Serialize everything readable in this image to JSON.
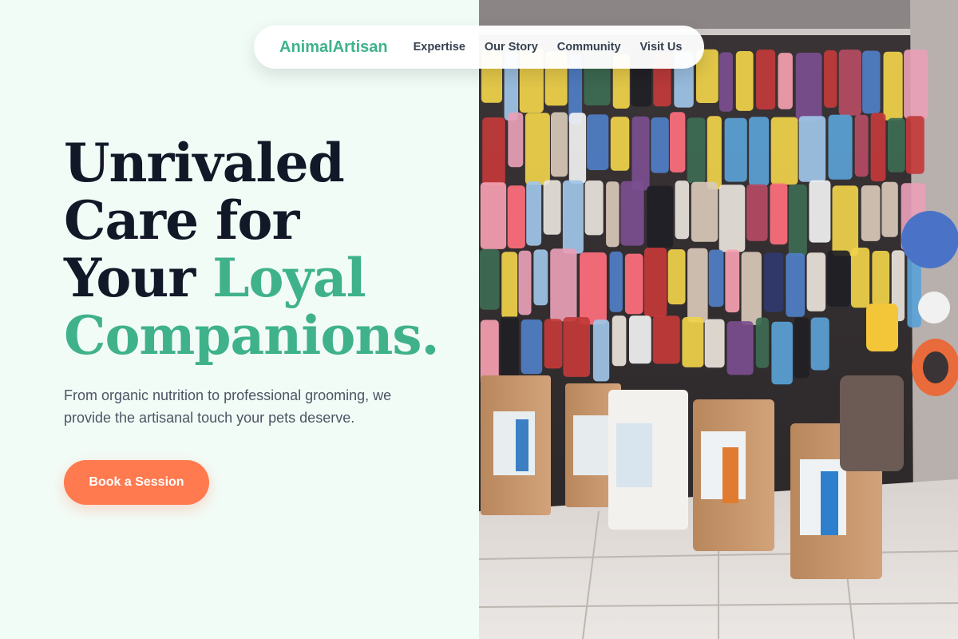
{
  "nav": {
    "logo": "AnimalArtisan",
    "links": [
      "Expertise",
      "Our Story",
      "Community",
      "Visit Us"
    ]
  },
  "hero": {
    "title_line1": "Unrivaled",
    "title_line2": "Care for",
    "title_line3_plain": "Your ",
    "title_line3_accent": "Loyal",
    "title_line4_accent": "Companions.",
    "subtitle": "From organic nutrition to professional grooming, we provide the artisanal touch your pets deserve.",
    "cta_label": "Book a Session"
  },
  "image": {
    "subject": "pet-store-wall-with-pet-clothes-and-cat-food-bags"
  },
  "colors": {
    "background": "#f2fcf7",
    "accent_green": "#3fb28b",
    "heading": "#111827",
    "body_text": "#4b5563",
    "cta": "#ff7a4f"
  }
}
